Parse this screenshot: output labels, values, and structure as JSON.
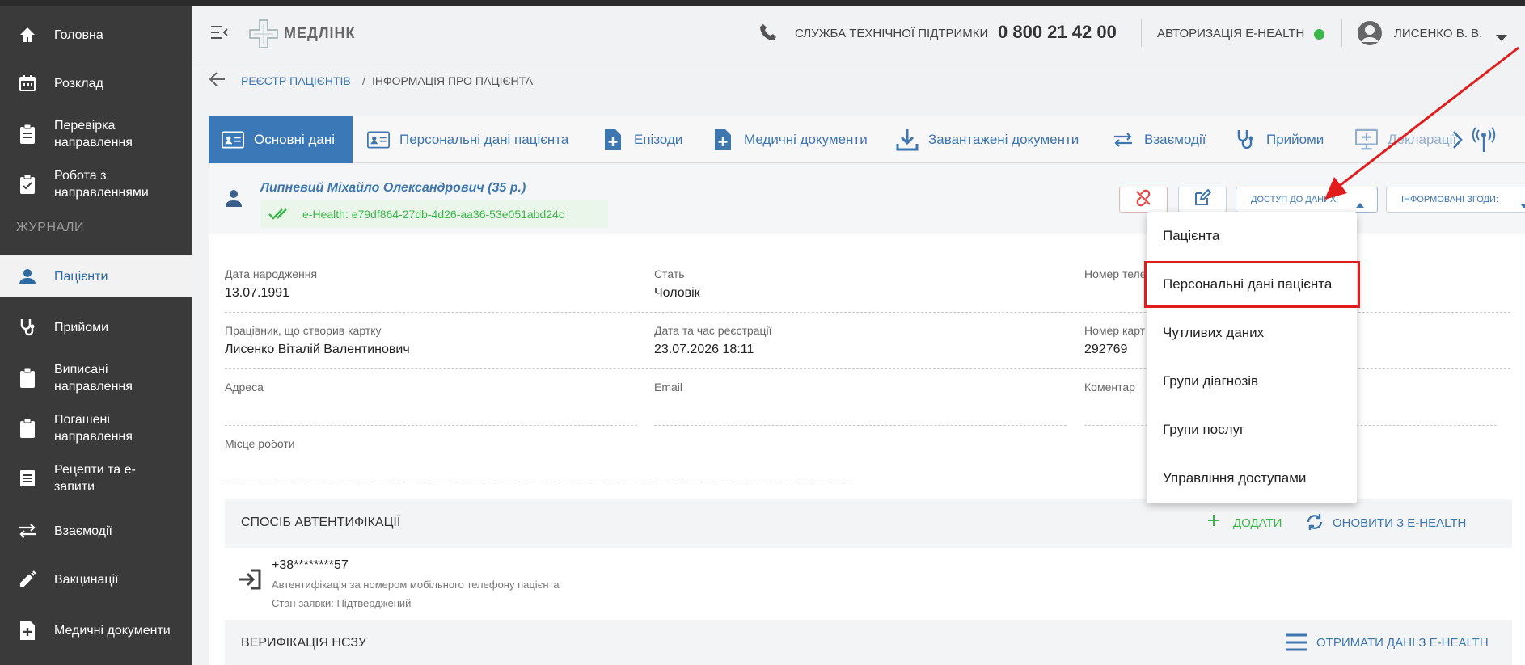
{
  "app": {
    "brand": "МЕДЛІНК"
  },
  "sidebar": {
    "items": [
      {
        "label": "Головна",
        "icon": "home-icon"
      },
      {
        "label": "Розклад",
        "icon": "calendar-icon"
      },
      {
        "label": "Перевірка направлення",
        "icon": "clipboard-icon"
      },
      {
        "label": "Робота з направленнями",
        "icon": "clipboard-check-icon"
      }
    ],
    "section": "ЖУРНАЛИ",
    "journal_items": [
      {
        "label": "Пацієнти",
        "icon": "person-icon",
        "active": true
      },
      {
        "label": "Прийоми",
        "icon": "stethoscope-icon"
      },
      {
        "label": "Виписані направлення",
        "icon": "clipboard-icon"
      },
      {
        "label": "Погашені направлення",
        "icon": "clipboard-icon"
      },
      {
        "label": "Рецепти та е-запити",
        "icon": "list-icon"
      },
      {
        "label": "Взаємодії",
        "icon": "swap-icon"
      },
      {
        "label": "Вакцинації",
        "icon": "syringe-icon"
      },
      {
        "label": "Медичні документи",
        "icon": "document-plus-icon"
      }
    ]
  },
  "header": {
    "support_label": "СЛУЖБА ТЕХНІЧНОЇ ПІДТРИМКИ",
    "support_phone": "0 800 21 42 00",
    "ehealth_auth": "АВТОРИЗАЦІЯ E-HEALTH",
    "status_color": "#3bb54a",
    "user": "ЛИСЕНКО В. В."
  },
  "breadcrumb": {
    "parent": "РЕЄСТР ПАЦІЄНТІВ",
    "sep": "/",
    "current": "ІНФОРМАЦІЯ ПРО ПАЦІЄНТА"
  },
  "tabs": [
    {
      "label": "Основні дані",
      "active": true
    },
    {
      "label": "Персональні дані пацієнта"
    },
    {
      "label": "Епізоди"
    },
    {
      "label": "Медичні документи"
    },
    {
      "label": "Завантажені документи"
    },
    {
      "label": "Взаємодії"
    },
    {
      "label": "Прийоми"
    },
    {
      "label": "Декларації"
    }
  ],
  "patient": {
    "name": "Липневий Міхайло Олександрович (35 р.)",
    "ehealth_id": "e-Health: e79df864-27db-4d26-aa36-53e051abd24c",
    "access_btn": "ДОСТУП ДО ДАНИХ:",
    "consent_btn": "ІНФОРМОВАНІ ЗГОДИ:"
  },
  "fields": {
    "birth_label": "Дата народження",
    "birth_value": "13.07.1991",
    "sex_label": "Стать",
    "sex_value": "Чоловік",
    "phone_label": "Номер теле",
    "creator_label": "Працівник, що створив картку",
    "creator_value": "Лисенко Віталій Валентинович",
    "reg_label": "Дата та час реєстрації",
    "reg_value": "23.07.2026 18:11",
    "card_label": "Номер карт",
    "card_value": "292769",
    "address_label": "Адреса",
    "email_label": "Email",
    "comment_label": "Коментар",
    "work_label": "Місце роботи"
  },
  "auth_section": {
    "title": "СПОСІБ АВТЕНТИФІКАЦІЇ",
    "add": "ДОДАТИ",
    "refresh": "ОНОВИТИ З E-HEALTH",
    "phone": "+38********57",
    "desc": "Автентифікація за номером мобільного телефону пацієнта",
    "status": "Стан заявки: Підтверджений"
  },
  "verify_section": {
    "title": "ВЕРИФІКАЦІЯ НСЗУ",
    "get": "ОТРИМАТИ ДАНІ З E-HEALTH"
  },
  "dropdown": {
    "items": [
      "Пацієнта",
      "Персональні дані пацієнта",
      "Чутливих даних",
      "Групи діагнозів",
      "Групи послуг",
      "Управління доступами"
    ],
    "highlighted_index": 1
  },
  "colors": {
    "accent": "#3a78b7",
    "annotation": "#e11c1c",
    "green": "#3bb54a"
  }
}
